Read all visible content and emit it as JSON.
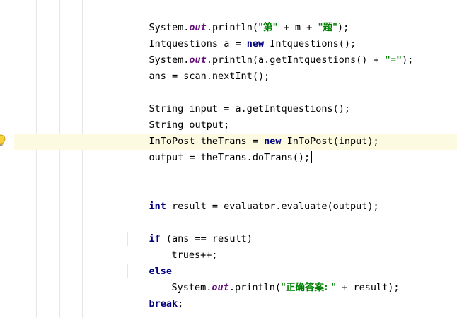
{
  "editor": {
    "lines": {
      "l1": {
        "t1": "System.",
        "t2": "out",
        "t3": ".println(",
        "t4": "\"第\"",
        "t5": " + m + ",
        "t6": "\"题\"",
        "t7": ");"
      },
      "l2": {
        "t1": "Intquestions",
        "t2": " a = ",
        "t3": "new",
        "t4": " Intquestions();"
      },
      "l3": {
        "t1": "System.",
        "t2": "out",
        "t3": ".println(a.getIntquestions() + ",
        "t4": "\"=\"",
        "t5": ");"
      },
      "l4": {
        "t1": "ans = scan.nextInt();"
      },
      "l5": {
        "t1": "String input = a.getIntquestions();"
      },
      "l6": {
        "t1": "String output;"
      },
      "l7": {
        "t1": "InToPost theTrans = ",
        "t2": "new",
        "t3": " InToPost(input);"
      },
      "l8": {
        "t1": "output = theTrans.doTrans();"
      },
      "l9": {
        "t1": "int",
        "t2": " result = evaluator.evaluate(output);"
      },
      "l10": {
        "t1": "if",
        "t2": " (ans == result)"
      },
      "l11": {
        "t1": "trues++;"
      },
      "l12": {
        "t1": "else"
      },
      "l13": {
        "t1": "System.",
        "t2": "out",
        "t3": ".println(",
        "t4": "\"正确答案: \"",
        "t5": " + result);"
      },
      "l14": {
        "t1": "break",
        "t2": ";"
      }
    },
    "colors": {
      "keyword": "#000080",
      "static_field": "#660e7a",
      "string": "#008000",
      "current_line": "#fcfae1",
      "indent_guide": "#e6e6e6"
    },
    "icons": {
      "gutter": "lightbulb-icon"
    }
  }
}
